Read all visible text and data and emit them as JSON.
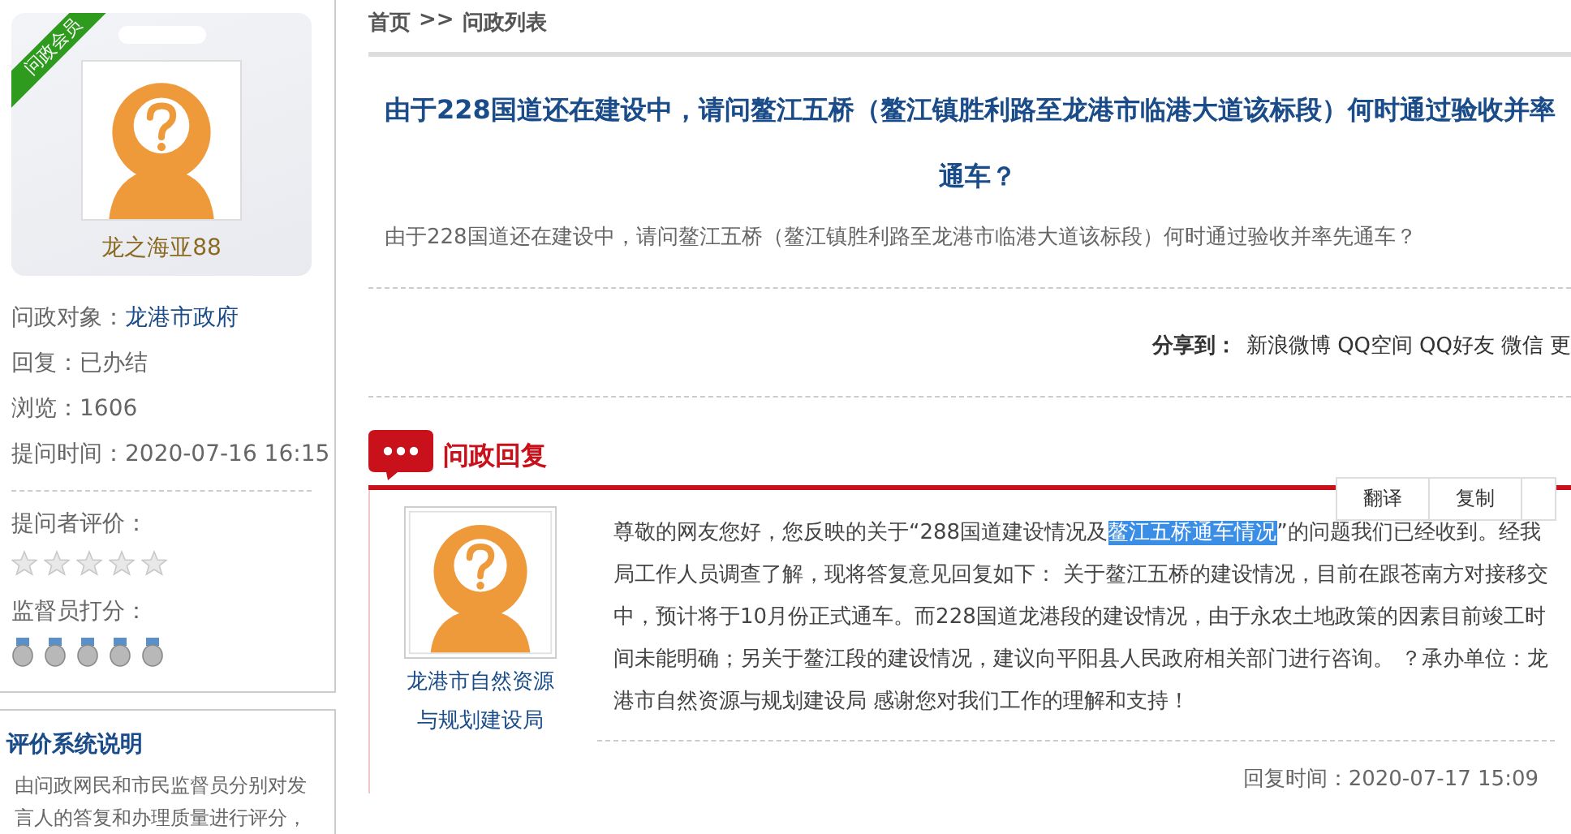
{
  "profile": {
    "badge": "问政会员",
    "name": "龙之海亚88"
  },
  "info": [
    {
      "label": "问政对象：",
      "value": "龙港市政府",
      "kind": "link"
    },
    {
      "label": "回复：",
      "value": "已办结",
      "kind": "text"
    },
    {
      "label": "浏览：",
      "value": "1606",
      "kind": "text"
    },
    {
      "label": "提问时间：",
      "value": "2020-07-16 16:15",
      "kind": "text"
    }
  ],
  "asker_rating": {
    "label": "提问者评价：",
    "stars": 0
  },
  "supervisor_score": {
    "label": "监督员打分：",
    "stars": 0
  },
  "rating_help": {
    "title": "评价系统说明",
    "text": "由问政网民和市民监督员分别对发言人的答复和办理质量进行评分，"
  },
  "breadcrumb": [
    {
      "label": "首页"
    },
    {
      "label": ">>"
    },
    {
      "label": "问政列表"
    }
  ],
  "question": {
    "title_lines": [
      "由于228国道还在建设中，请问鳌江五桥（鳌江镇胜利路至龙港市临港大道该标段）何时通过验收并率",
      "通车？"
    ],
    "body": "由于228国道还在建设中，请问鳌江五桥（鳌江镇胜利路至龙港市临港大道该标段）何时通过验收并率先通车？"
  },
  "share": {
    "label": "分享到：",
    "links": [
      "新浪微博",
      "QQ空间",
      "QQ好友",
      "微信",
      "更"
    ]
  },
  "reply": {
    "heading": "问政回复",
    "department": "龙港市自然资源与规划建设局",
    "segments": [
      {
        "text": "尊敬的网友您好，您反映的关于“288国道建设情况及",
        "selected": false
      },
      {
        "text": "鳌江五桥通车情况",
        "selected": true
      },
      {
        "text": "”的问题我们已经收到。经我局工作人员调查了解，现将答复意见回复如下： 关于鳌江五桥的建设情况，目前在跟苍南方对接移交中，预计将于10月份正式通车。而228国道龙港段的建设情况，由于永农土地政策的因素目前竣工时间未能明确；另关于鳌江段的建设情况，建议向平阳县人民政府相关部门进行咨询。 ？承办单位：龙港市自然资源与规划建设局 感谢您对我们工作的理解和支持！",
        "selected": false
      }
    ],
    "time": "回复时间：2020-07-17 15:09"
  },
  "selection_menu": [
    "翻译",
    "复制"
  ]
}
